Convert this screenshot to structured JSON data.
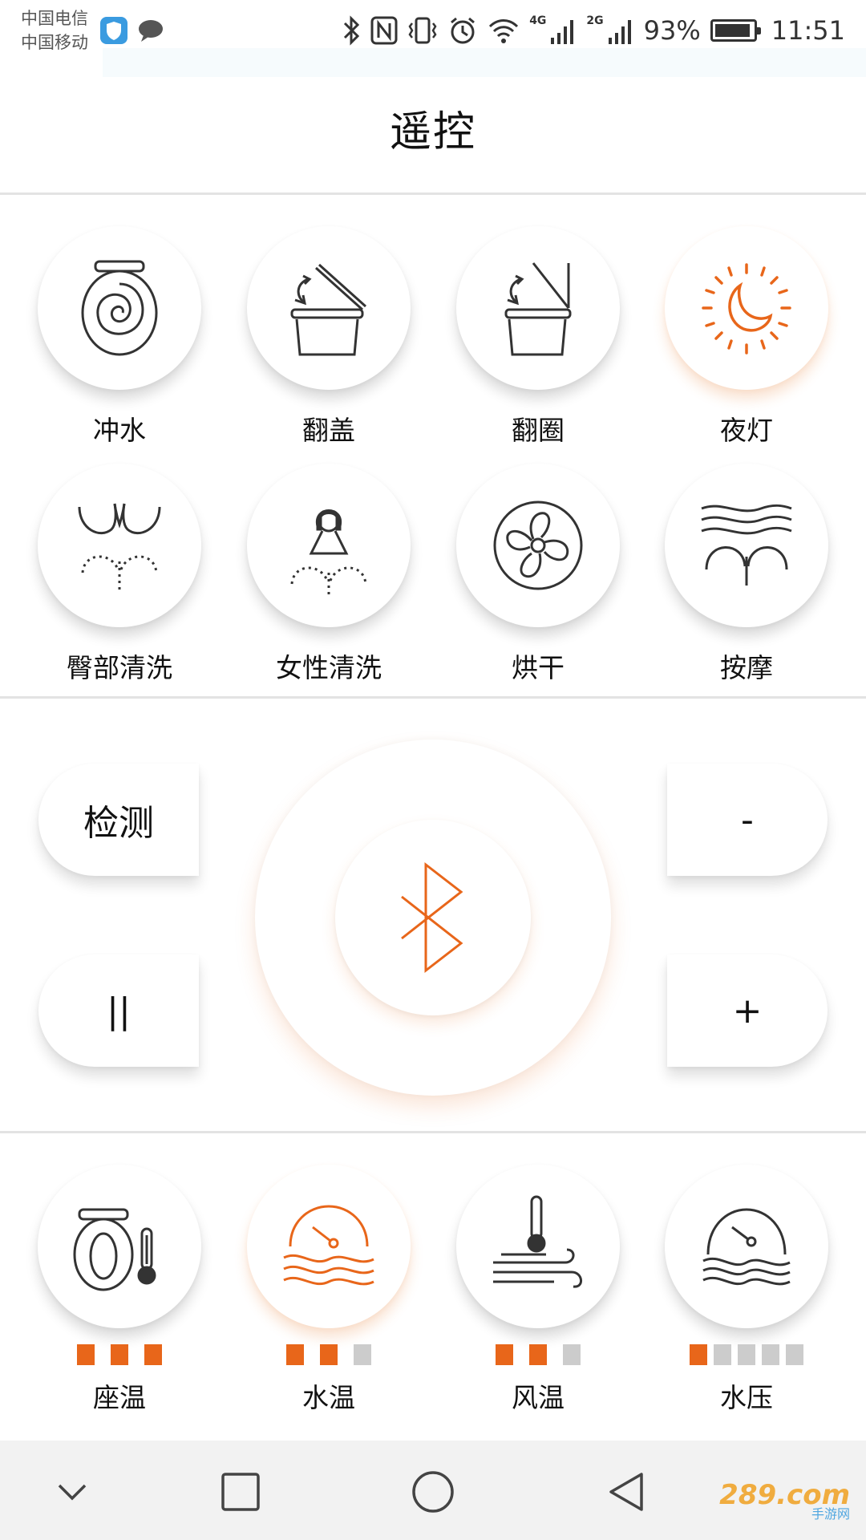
{
  "status_bar": {
    "carrier_1": "中国电信",
    "carrier_2": "中国移动",
    "icons": [
      "shield-app-icon",
      "chat-app-icon",
      "bluetooth-icon",
      "nfc-icon",
      "vibrate-icon",
      "alarm-icon",
      "wifi-icon",
      "signal-4g-icon",
      "signal-2g-icon"
    ],
    "net_1": "4G",
    "net_2": "2G",
    "battery_pct": "93%",
    "battery_level": 0.93,
    "time": "11:51"
  },
  "header": {
    "title": "遥控"
  },
  "functions": [
    {
      "id": "flush",
      "label": "冲水",
      "icon": "toilet-flush-icon",
      "active": false
    },
    {
      "id": "lid",
      "label": "翻盖",
      "icon": "lid-flip-icon",
      "active": false
    },
    {
      "id": "seat",
      "label": "翻圈",
      "icon": "seat-flip-icon",
      "active": false
    },
    {
      "id": "nightlight",
      "label": "夜灯",
      "icon": "night-light-icon",
      "active": true
    },
    {
      "id": "rear_wash",
      "label": "臀部清洗",
      "icon": "rear-wash-icon",
      "active": false
    },
    {
      "id": "female_wash",
      "label": "女性清洗",
      "icon": "female-wash-icon",
      "active": false
    },
    {
      "id": "dry",
      "label": "烘干",
      "icon": "fan-dry-icon",
      "active": false
    },
    {
      "id": "massage",
      "label": "按摩",
      "icon": "massage-icon",
      "active": false
    }
  ],
  "controls": {
    "detect_label": "检测",
    "pause_label": "||",
    "minus_label": "-",
    "plus_label": "+",
    "bluetooth_icon": "bluetooth-icon"
  },
  "settings": [
    {
      "id": "seat_temp",
      "label": "座温",
      "icon": "seat-temp-icon",
      "level": 3,
      "max": 3,
      "active": false
    },
    {
      "id": "water_temp",
      "label": "水温",
      "icon": "water-temp-icon",
      "level": 2,
      "max": 3,
      "active": true
    },
    {
      "id": "air_temp",
      "label": "风温",
      "icon": "air-temp-icon",
      "level": 2,
      "max": 3,
      "active": false
    },
    {
      "id": "water_pressure",
      "label": "水压",
      "icon": "water-pressure-icon",
      "level": 1,
      "max": 5,
      "active": false
    }
  ],
  "colors": {
    "accent": "#e8661a",
    "icon_stroke": "#333333",
    "inactive_dot": "#cccccc"
  },
  "nav": {
    "icons": [
      "collapse-chevron-icon",
      "recents-square-icon",
      "home-circle-icon",
      "back-triangle-icon"
    ]
  },
  "watermark": {
    "brand": "289.com",
    "sub": "手游网"
  }
}
